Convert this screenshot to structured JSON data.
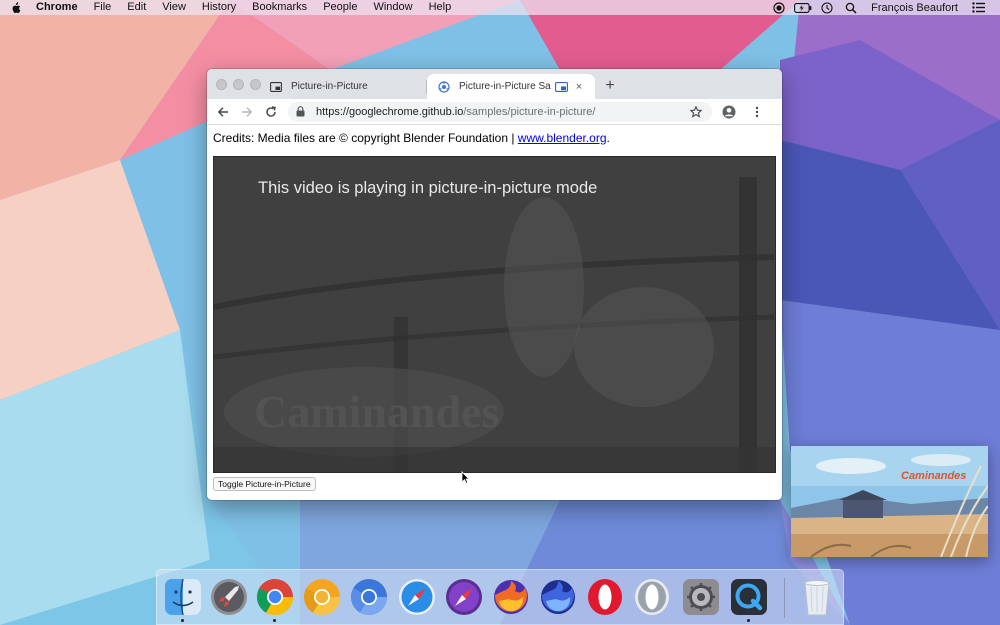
{
  "menubar": {
    "app_name": "Chrome",
    "menus": [
      "File",
      "Edit",
      "View",
      "History",
      "Bookmarks",
      "People",
      "Window",
      "Help"
    ],
    "user_name": "François Beaufort"
  },
  "browser": {
    "tabs": [
      {
        "title": "Picture-in-Picture",
        "active": false
      },
      {
        "title": "Picture-in-Picture Sample",
        "active": true
      }
    ],
    "new_tab": "+",
    "close_glyph": "×",
    "url": {
      "host": "https://googlechrome.github.io",
      "path": "/samples/picture-in-picture/"
    },
    "page": {
      "credits_text": "Credits: Media files are © copyright Blender Foundation | ",
      "credits_link": "www.blender.org",
      "credits_end": ".",
      "video_overlay": "This video is playing in picture-in-picture mode",
      "toggle_button": "Toggle Picture-in-Picture"
    }
  },
  "pip_window": {
    "logo_text": "Caminandes"
  },
  "dock": {
    "apps": [
      {
        "name": "Finder",
        "icon": "finder-icon",
        "running": true
      },
      {
        "name": "Launchpad",
        "icon": "rocket-icon",
        "running": false
      },
      {
        "name": "Google Chrome",
        "icon": "chrome-icon",
        "running": true
      },
      {
        "name": "Chrome Canary",
        "icon": "chrome-canary-icon",
        "running": false
      },
      {
        "name": "Chromium",
        "icon": "chromium-icon",
        "running": false
      },
      {
        "name": "Safari",
        "icon": "safari-icon",
        "running": false
      },
      {
        "name": "Safari Technology Preview",
        "icon": "safari-preview-icon",
        "running": false
      },
      {
        "name": "Firefox",
        "icon": "firefox-icon",
        "running": false
      },
      {
        "name": "Firefox Nightly",
        "icon": "firefox-nightly-icon",
        "running": false
      },
      {
        "name": "Opera",
        "icon": "opera-icon",
        "running": false
      },
      {
        "name": "Opera Beta",
        "icon": "opera-beta-icon",
        "running": false
      },
      {
        "name": "System Preferences",
        "icon": "gear-icon",
        "running": false
      },
      {
        "name": "QuickTime Player",
        "icon": "quicktime-icon",
        "running": true
      },
      {
        "name": "Trash",
        "icon": "trash-icon",
        "running": false
      }
    ]
  }
}
